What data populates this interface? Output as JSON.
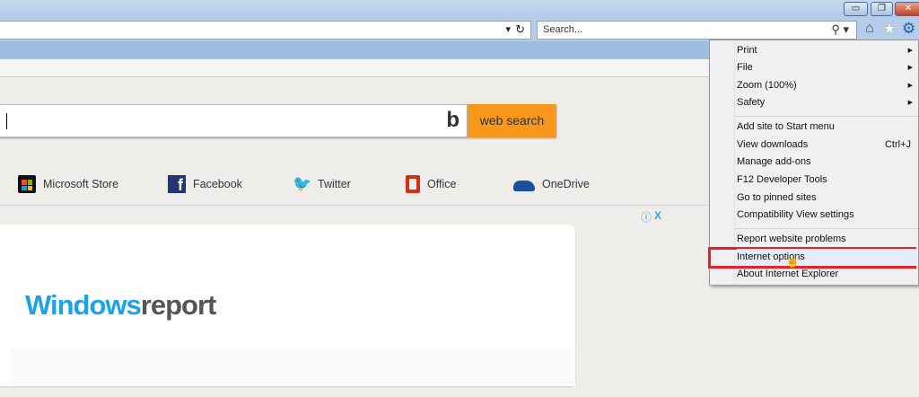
{
  "window": {
    "minimize": "▭",
    "restore": "❐",
    "close": "✕"
  },
  "toolbar": {
    "search_placeholder": "Search...",
    "refresh": "↻",
    "dropdown": "▾"
  },
  "page": {
    "search_button": "web search",
    "links": [
      {
        "label": "Microsoft Store"
      },
      {
        "label": "Facebook"
      },
      {
        "label": "Twitter"
      },
      {
        "label": "Office"
      },
      {
        "label": "OneDrive"
      }
    ],
    "ad_close": "X",
    "logo_text": "Windowsreport"
  },
  "menu": {
    "items": [
      {
        "label": "Print",
        "submenu": true
      },
      {
        "label": "File",
        "submenu": true
      },
      {
        "label": "Zoom (100%)",
        "submenu": true
      },
      {
        "label": "Safety",
        "submenu": true
      },
      {
        "label": "Add site to Start menu"
      },
      {
        "label": "View downloads",
        "shortcut": "Ctrl+J"
      },
      {
        "label": "Manage add-ons"
      },
      {
        "label": "F12 Developer Tools"
      },
      {
        "label": "Go to pinned sites"
      },
      {
        "label": "Compatibility View settings"
      },
      {
        "label": "Report website problems"
      },
      {
        "label": "Internet options",
        "highlighted": true
      },
      {
        "label": "About Internet Explorer"
      }
    ]
  },
  "colors": {
    "accent": "#f7981d",
    "highlight": "#e8202a"
  }
}
